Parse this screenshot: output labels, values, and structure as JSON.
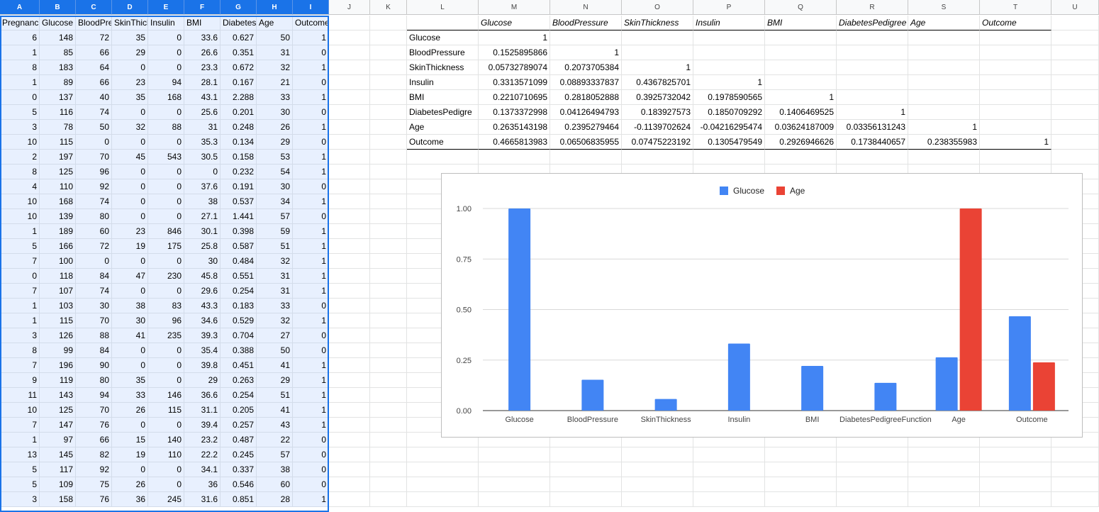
{
  "columns": [
    "A",
    "B",
    "C",
    "D",
    "E",
    "F",
    "G",
    "H",
    "I",
    "J",
    "K",
    "L",
    "M",
    "N",
    "O",
    "P",
    "Q",
    "R",
    "S",
    "T",
    "U"
  ],
  "data_headers": [
    "Pregnancies",
    "Glucose",
    "BloodPressure",
    "SkinThickness",
    "Insulin",
    "BMI",
    "DiabetesPedigreeFunction",
    "Age",
    "Outcome"
  ],
  "data_rows": [
    [
      "6",
      "148",
      "72",
      "35",
      "0",
      "33.6",
      "0.627",
      "50",
      "1"
    ],
    [
      "1",
      "85",
      "66",
      "29",
      "0",
      "26.6",
      "0.351",
      "31",
      "0"
    ],
    [
      "8",
      "183",
      "64",
      "0",
      "0",
      "23.3",
      "0.672",
      "32",
      "1"
    ],
    [
      "1",
      "89",
      "66",
      "23",
      "94",
      "28.1",
      "0.167",
      "21",
      "0"
    ],
    [
      "0",
      "137",
      "40",
      "35",
      "168",
      "43.1",
      "2.288",
      "33",
      "1"
    ],
    [
      "5",
      "116",
      "74",
      "0",
      "0",
      "25.6",
      "0.201",
      "30",
      "0"
    ],
    [
      "3",
      "78",
      "50",
      "32",
      "88",
      "31",
      "0.248",
      "26",
      "1"
    ],
    [
      "10",
      "115",
      "0",
      "0",
      "0",
      "35.3",
      "0.134",
      "29",
      "0"
    ],
    [
      "2",
      "197",
      "70",
      "45",
      "543",
      "30.5",
      "0.158",
      "53",
      "1"
    ],
    [
      "8",
      "125",
      "96",
      "0",
      "0",
      "0",
      "0.232",
      "54",
      "1"
    ],
    [
      "4",
      "110",
      "92",
      "0",
      "0",
      "37.6",
      "0.191",
      "30",
      "0"
    ],
    [
      "10",
      "168",
      "74",
      "0",
      "0",
      "38",
      "0.537",
      "34",
      "1"
    ],
    [
      "10",
      "139",
      "80",
      "0",
      "0",
      "27.1",
      "1.441",
      "57",
      "0"
    ],
    [
      "1",
      "189",
      "60",
      "23",
      "846",
      "30.1",
      "0.398",
      "59",
      "1"
    ],
    [
      "5",
      "166",
      "72",
      "19",
      "175",
      "25.8",
      "0.587",
      "51",
      "1"
    ],
    [
      "7",
      "100",
      "0",
      "0",
      "0",
      "30",
      "0.484",
      "32",
      "1"
    ],
    [
      "0",
      "118",
      "84",
      "47",
      "230",
      "45.8",
      "0.551",
      "31",
      "1"
    ],
    [
      "7",
      "107",
      "74",
      "0",
      "0",
      "29.6",
      "0.254",
      "31",
      "1"
    ],
    [
      "1",
      "103",
      "30",
      "38",
      "83",
      "43.3",
      "0.183",
      "33",
      "0"
    ],
    [
      "1",
      "115",
      "70",
      "30",
      "96",
      "34.6",
      "0.529",
      "32",
      "1"
    ],
    [
      "3",
      "126",
      "88",
      "41",
      "235",
      "39.3",
      "0.704",
      "27",
      "0"
    ],
    [
      "8",
      "99",
      "84",
      "0",
      "0",
      "35.4",
      "0.388",
      "50",
      "0"
    ],
    [
      "7",
      "196",
      "90",
      "0",
      "0",
      "39.8",
      "0.451",
      "41",
      "1"
    ],
    [
      "9",
      "119",
      "80",
      "35",
      "0",
      "29",
      "0.263",
      "29",
      "1"
    ],
    [
      "11",
      "143",
      "94",
      "33",
      "146",
      "36.6",
      "0.254",
      "51",
      "1"
    ],
    [
      "10",
      "125",
      "70",
      "26",
      "115",
      "31.1",
      "0.205",
      "41",
      "1"
    ],
    [
      "7",
      "147",
      "76",
      "0",
      "0",
      "39.4",
      "0.257",
      "43",
      "1"
    ],
    [
      "1",
      "97",
      "66",
      "15",
      "140",
      "23.2",
      "0.487",
      "22",
      "0"
    ],
    [
      "13",
      "145",
      "82",
      "19",
      "110",
      "22.2",
      "0.245",
      "57",
      "0"
    ],
    [
      "5",
      "117",
      "92",
      "0",
      "0",
      "34.1",
      "0.337",
      "38",
      "0"
    ],
    [
      "5",
      "109",
      "75",
      "26",
      "0",
      "36",
      "0.546",
      "60",
      "0"
    ],
    [
      "3",
      "158",
      "76",
      "36",
      "245",
      "31.6",
      "0.851",
      "28",
      "1"
    ]
  ],
  "corr_headers": [
    "Glucose",
    "BloodPressure",
    "SkinThickness",
    "Insulin",
    "BMI",
    "DiabetesPedigree",
    "Age",
    "Outcome"
  ],
  "corr_rows": [
    {
      "label": "Glucose",
      "values": [
        "1",
        "",
        "",
        "",
        "",
        "",
        "",
        ""
      ]
    },
    {
      "label": "BloodPressure",
      "values": [
        "0.1525895866",
        "1",
        "",
        "",
        "",
        "",
        "",
        ""
      ]
    },
    {
      "label": "SkinThickness",
      "values": [
        "0.05732789074",
        "0.2073705384",
        "1",
        "",
        "",
        "",
        "",
        ""
      ]
    },
    {
      "label": "Insulin",
      "values": [
        "0.3313571099",
        "0.08893337837",
        "0.4367825701",
        "1",
        "",
        "",
        "",
        ""
      ]
    },
    {
      "label": "BMI",
      "values": [
        "0.2210710695",
        "0.2818052888",
        "0.3925732042",
        "0.1978590565",
        "1",
        "",
        "",
        ""
      ]
    },
    {
      "label": "DiabetesPedigre",
      "values": [
        "0.1373372998",
        "0.04126494793",
        "0.183927573",
        "0.1850709292",
        "0.1406469525",
        "1",
        "",
        ""
      ]
    },
    {
      "label": "Age",
      "values": [
        "0.2635143198",
        "0.2395279464",
        "-0.1139702624",
        "-0.04216295474",
        "0.03624187009",
        "0.03356131243",
        "1",
        ""
      ]
    },
    {
      "label": "Outcome",
      "values": [
        "0.4665813983",
        "0.06506835955",
        "0.07475223192",
        "0.1305479549",
        "0.2926946626",
        "0.1738440657",
        "0.238355983",
        "1"
      ]
    }
  ],
  "colors": {
    "selection": "#1a73e8",
    "selection_fill": "#e8f0fe",
    "series_glucose": "#4285f4",
    "series_age": "#ea4335"
  },
  "chart_data": {
    "type": "bar",
    "title": "",
    "xlabel": "",
    "ylabel": "",
    "categories": [
      "Glucose",
      "BloodPressure",
      "SkinThickness",
      "Insulin",
      "BMI",
      "DiabetesPedigreeFunction",
      "Age",
      "Outcome"
    ],
    "series": [
      {
        "name": "Glucose",
        "color": "#4285f4",
        "values": [
          1,
          0.1526,
          0.0573,
          0.3314,
          0.2211,
          0.1373,
          0.2635,
          0.4666
        ]
      },
      {
        "name": "Age",
        "color": "#ea4335",
        "values": [
          null,
          null,
          null,
          null,
          null,
          null,
          1,
          0.2384
        ]
      }
    ],
    "ylim": [
      0,
      1
    ],
    "yticks": [
      "0.00",
      "0.25",
      "0.50",
      "0.75",
      "1.00"
    ],
    "ytick_values": [
      0,
      0.25,
      0.5,
      0.75,
      1
    ],
    "grid": true,
    "legend": "top-center"
  }
}
